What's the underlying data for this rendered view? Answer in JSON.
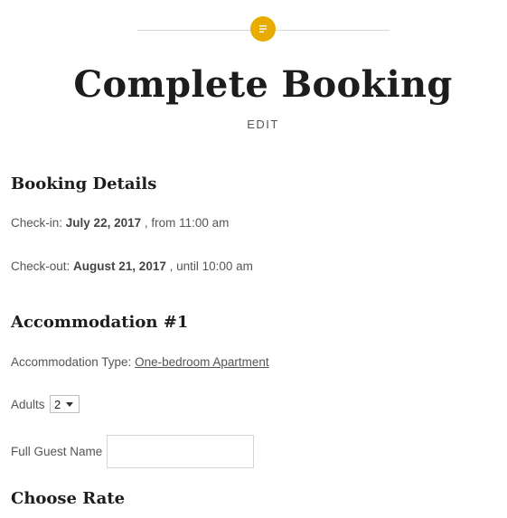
{
  "header": {
    "post_format_icon": "standard-post-icon",
    "accent_color": "#e8ab00",
    "title": "Complete Booking",
    "edit_label": "EDIT"
  },
  "booking_details": {
    "heading": "Booking Details",
    "checkin": {
      "label": "Check-in:",
      "date": "July 22, 2017",
      "time_text": ", from 11:00 am"
    },
    "checkout": {
      "label": "Check-out:",
      "date": "August 21, 2017",
      "time_text": ", until 10:00 am"
    }
  },
  "accommodation": {
    "heading": "Accommodation #1",
    "type_label": "Accommodation Type:",
    "type_link": "One-bedroom Apartment",
    "adults_label": "Adults",
    "adults_value": "2",
    "guest_name_label": "Full Guest Name",
    "guest_name_value": "",
    "guest_name_placeholder": ""
  },
  "rates": {
    "heading": "Choose Rate"
  }
}
